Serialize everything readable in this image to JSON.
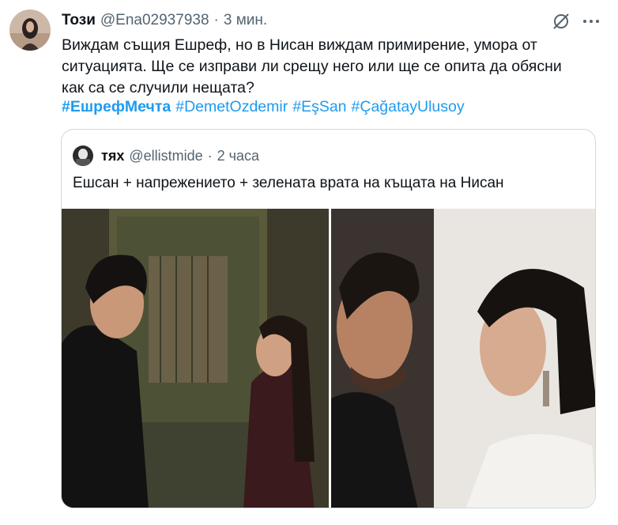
{
  "tweet": {
    "author_name": "Този",
    "author_handle": "@Ena02937938",
    "separator": "·",
    "time": "3 мин.",
    "text": "Виждам същия Ешреф, но в Нисан виждам примирение, умора от ситуацията. Ще се изправи ли срещу него или ще се опита да обясни как са се случили нещата?",
    "hashtags": [
      "#ЕшрефМечта",
      "#DemetOzdemir",
      "#EşSan",
      "#ÇağatayUlusoy"
    ],
    "icons": {
      "grok": "grok-icon",
      "more": "more-dots-icon",
      "avatar": "avatar"
    }
  },
  "quote": {
    "author_name": "тях",
    "author_handle": "@ellistmide",
    "separator": "·",
    "time": "2 часа",
    "text": "Ешсан + напрежението + зелената врата на къщата на Нисан"
  },
  "colors": {
    "link": "#1d9bf0",
    "secondary": "#536471",
    "border": "#cfd9de"
  }
}
